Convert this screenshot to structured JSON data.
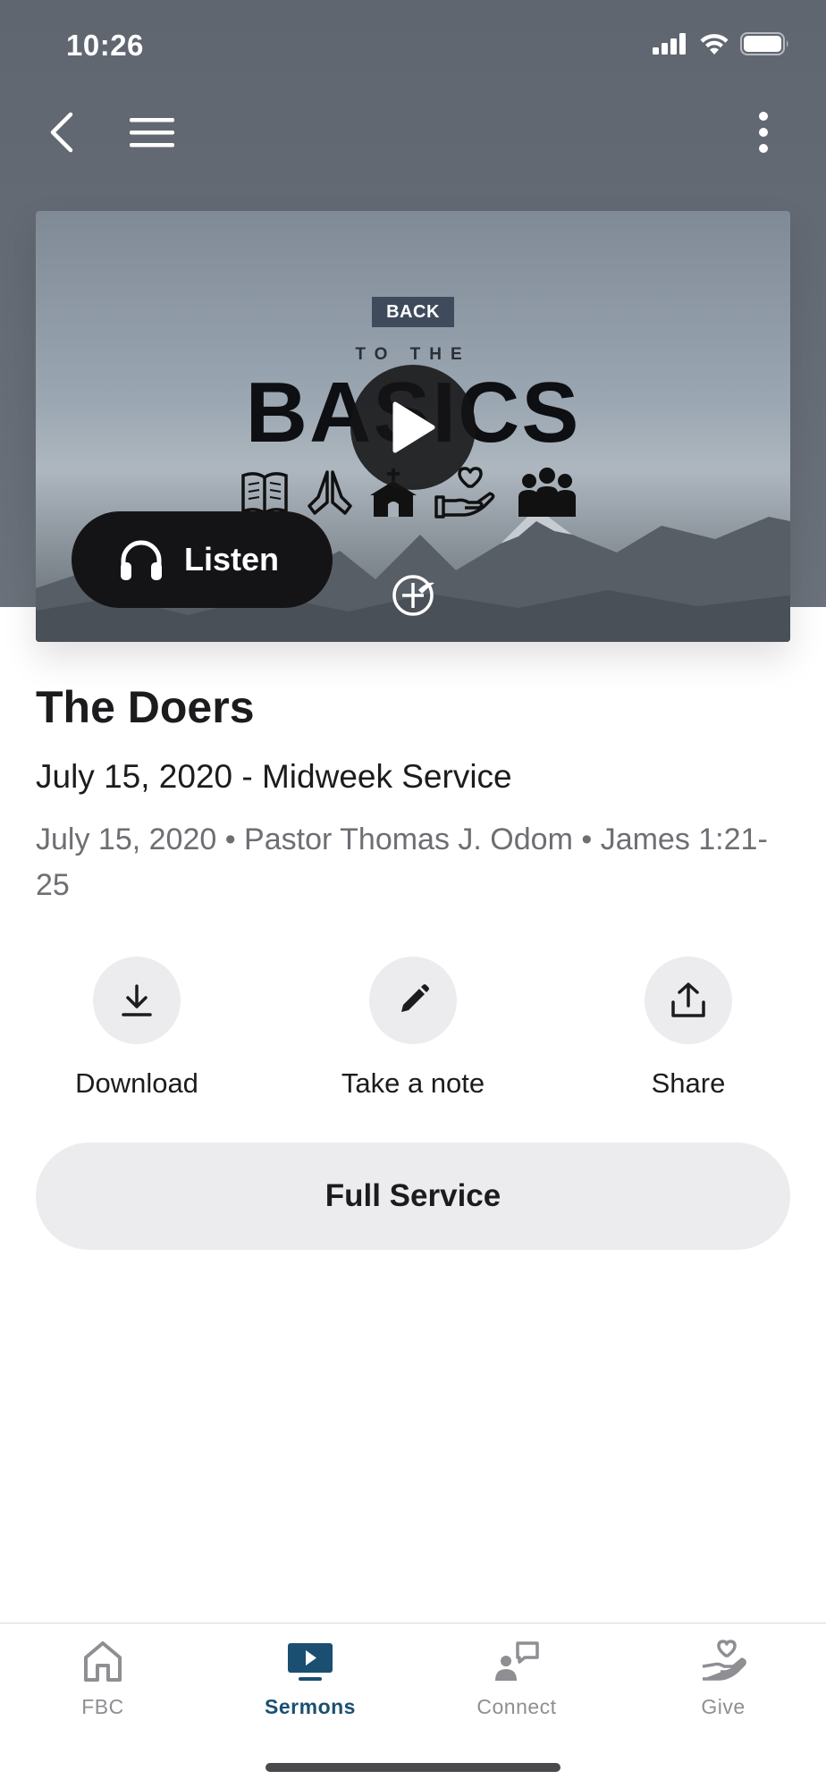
{
  "status_bar": {
    "time": "10:26",
    "icons": [
      "signal-icon",
      "wifi-icon",
      "battery-icon"
    ]
  },
  "topbar": {
    "icons": [
      "back-chevron-icon",
      "hamburger-menu-icon",
      "more-vertical-icon"
    ]
  },
  "hero": {
    "badge": "BACK",
    "kicker": "TO THE",
    "headline": "BASICS",
    "icons": [
      "bible-icon",
      "praying-hands-icon",
      "church-icon",
      "heart-hand-icon",
      "people-icon"
    ],
    "listen_label": "Listen",
    "play_icon": "play-icon"
  },
  "sermon": {
    "title": "The Doers",
    "subtitle": "July 15, 2020 - Midweek Service",
    "meta": "July 15, 2020 • Pastor Thomas J. Odom • James 1:21-25"
  },
  "actions": [
    {
      "label": "Download",
      "icon": "download-icon"
    },
    {
      "label": "Take a note",
      "icon": "pencil-icon"
    },
    {
      "label": "Share",
      "icon": "share-icon"
    }
  ],
  "full_service_label": "Full Service",
  "tabs": [
    {
      "label": "FBC",
      "icon": "home-icon",
      "active": false
    },
    {
      "label": "Sermons",
      "icon": "tv-play-icon",
      "active": true
    },
    {
      "label": "Connect",
      "icon": "chat-person-icon",
      "active": false
    },
    {
      "label": "Give",
      "icon": "heart-hand-icon",
      "active": false
    }
  ],
  "colors": {
    "accent": "#1b4f72",
    "header": "#636a73",
    "button_bg": "#ececee",
    "inactive_tab": "#8e8e93"
  }
}
